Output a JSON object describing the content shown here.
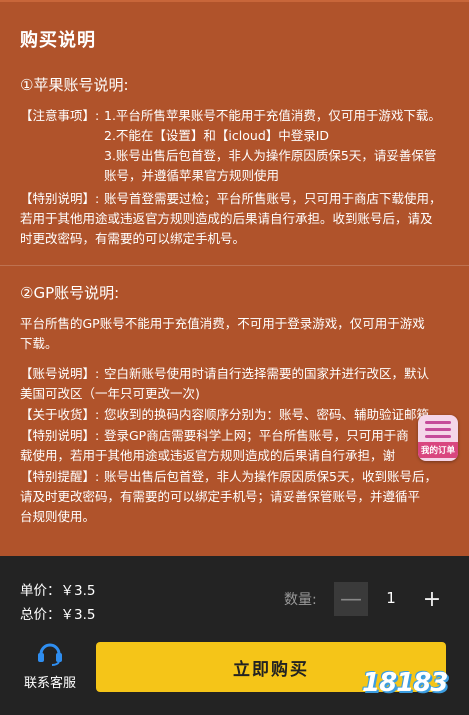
{
  "content": {
    "title": "购买说明",
    "apple": {
      "heading": "①苹果账号说明:",
      "notice_label": "【注意事项】:",
      "notice_1": "1.平台所售苹果账号不能用于充值消费，仅可用于游戏下载。",
      "notice_2": "2.不能在【设置】和【icloud】中登录ID",
      "notice_3a": "3.账号出售后包首登，非人为操作原因质保5天，请妥善保管",
      "notice_3b": "账号，并遵循苹果官方规则使用",
      "special_label": "【特别说明】:",
      "special_a": "账号首登需要过检；平台所售账号，只可用于商店下载使用，",
      "special_b": "若用于其他用途或违返官方规则造成的后果请自行承担。收到账号后，请及",
      "special_c": "时更改密码，有需要的可以绑定手机号。"
    },
    "gp": {
      "heading": "②GP账号说明:",
      "intro_a": "平台所售的GP账号不能用于充值消费，不可用于登录游戏，仅可用于游戏",
      "intro_b": "下载。",
      "account_label": "【账号说明】:",
      "account_a": "空白新账号使用时请自行选择需要的国家并进行改区，默认",
      "account_b": "美国可改区（一年只可更改一次)",
      "receipt_label": "【关于收货】:",
      "receipt_a": "您收到的换码内容顺序分别为：账号、密码、辅助验证邮箱。",
      "special_label": "【特别说明】:",
      "special_a": "登录GP商店需要科学上网；平台所售账号，只可用于商",
      "special_b": "载使用，若用于其他用途或违返官方规则造成的后果请自行承担，谢",
      "tips_label": "【特别提醒】:",
      "tips_a": "账号出售后包首登，非人为操作原因质保5天，收到账号后，",
      "tips_b": "请及时更改密码，有需要的可以绑定手机号；请妥善保管账号，并遵循平",
      "tips_c": "台规则使用。"
    }
  },
  "float_button": {
    "label": "我的订单",
    "icon": "order-list-icon"
  },
  "bottom_bar": {
    "unit_price": "单价：￥3.5",
    "total_price": "总价：￥3.5",
    "quantity_label": "数量:",
    "quantity_value": "1",
    "minus_label": "—",
    "plus_label": "+",
    "support_label": "联系客服",
    "support_icon": "headset-icon",
    "buy_label": "立即购买",
    "watermark": "18183"
  },
  "colors": {
    "background": "#b0532b",
    "bottom_bar": "#232323",
    "buy_button": "#f5c518",
    "support_icon": "#2f8ef0"
  }
}
